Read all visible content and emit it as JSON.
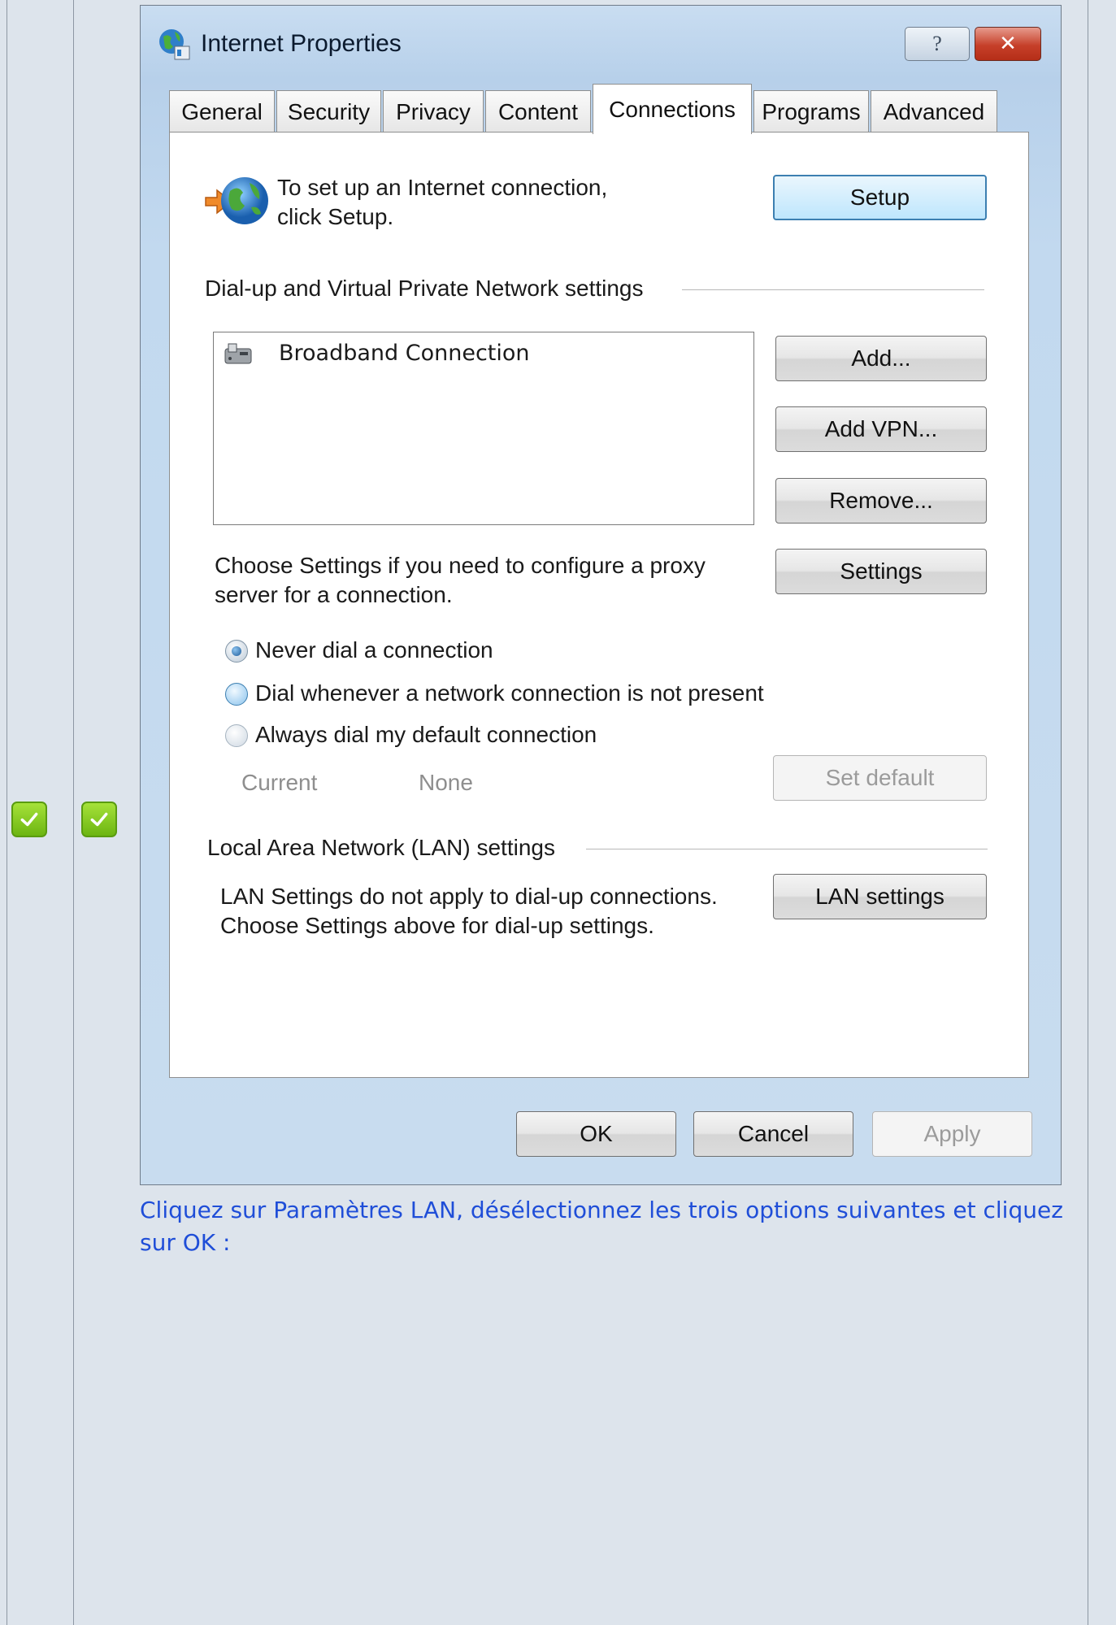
{
  "window": {
    "title": "Internet Properties",
    "help_glyph": "?",
    "close_glyph": "✕"
  },
  "tabs": [
    "General",
    "Security",
    "Privacy",
    "Content",
    "Connections",
    "Programs",
    "Advanced"
  ],
  "active_tab": "Connections",
  "connections": {
    "setup_text": "To set up an Internet connection, click Setup.",
    "setup_button": "Setup",
    "dialup_section": "Dial-up and Virtual Private Network settings",
    "connection_item": "Broadband Connection",
    "add_button": "Add...",
    "add_vpn_button": "Add VPN...",
    "remove_button": "Remove...",
    "proxy_text": "Choose Settings if you need to configure a proxy server for a connection.",
    "settings_button": "Settings",
    "radio_never": "Never dial a connection",
    "radio_whenever": "Dial whenever a network connection is not present",
    "radio_always": "Always dial my default connection",
    "current_label": "Current",
    "current_value": "None",
    "set_default_button": "Set default",
    "lan_section": "Local Area Network (LAN) settings",
    "lan_text_1": "LAN Settings do not apply to dial-up connections.",
    "lan_text_2": "Choose Settings above for dial-up settings.",
    "lan_button": "LAN settings"
  },
  "footer": {
    "ok": "OK",
    "cancel": "Cancel",
    "apply": "Apply"
  },
  "caption": "Cliquez sur Paramètres LAN, désélectionnez les trois options suivantes et cliquez sur OK :",
  "colors": {
    "check_green": "#7cc41a",
    "caption_blue": "#1f4ed8",
    "close_red": "#c6402a"
  },
  "icons": [
    "check-icon",
    "globe-icon",
    "setup-arrow-icon",
    "modem-icon"
  ]
}
